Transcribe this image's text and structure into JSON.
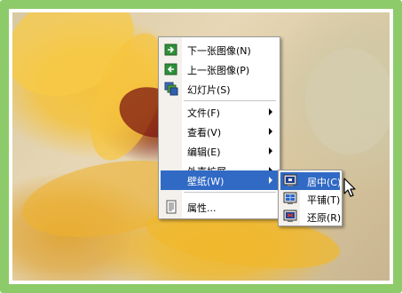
{
  "menu": {
    "items": [
      {
        "label": "下一张图像(N)",
        "icon": "next-image-icon"
      },
      {
        "label": "上一张图像(P)",
        "icon": "previous-image-icon"
      },
      {
        "label": "幻灯片(S)",
        "icon": "slideshow-icon"
      },
      {
        "label": "文件(F)",
        "submenu": true
      },
      {
        "label": "查看(V)",
        "submenu": true
      },
      {
        "label": "编辑(E)",
        "submenu": true
      },
      {
        "label": "外壳扩展",
        "submenu": true
      },
      {
        "label": "壁纸(W)",
        "submenu": true,
        "selected": true
      },
      {
        "label": "属性...",
        "icon": "properties-icon"
      }
    ]
  },
  "submenu": {
    "items": [
      {
        "label": "居中(C)",
        "icon": "monitor-center-icon",
        "highlighted": true
      },
      {
        "label": "平铺(T)",
        "icon": "monitor-tile-icon"
      },
      {
        "label": "还原(R)",
        "icon": "monitor-restore-icon"
      }
    ]
  },
  "colors": {
    "frame": "#8dcb6a",
    "highlight": "#316ac5"
  }
}
